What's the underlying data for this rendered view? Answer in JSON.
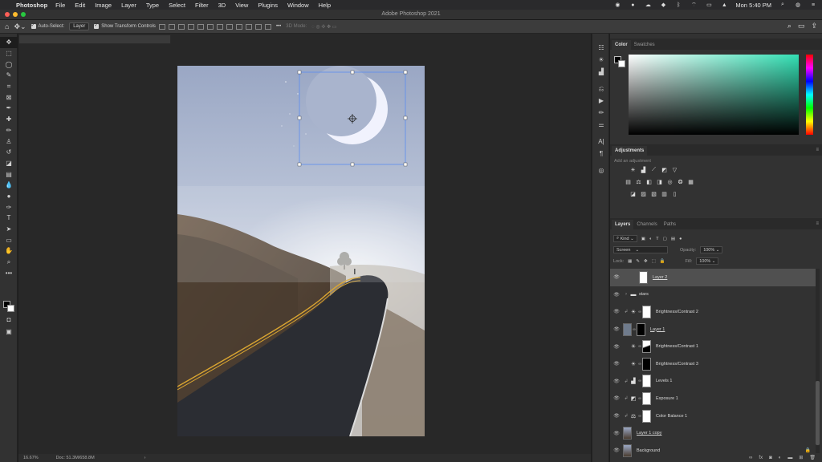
{
  "menubar": {
    "app_name": "Photoshop",
    "items": [
      "File",
      "Edit",
      "Image",
      "Layer",
      "Type",
      "Select",
      "Filter",
      "3D",
      "View",
      "Plugins",
      "Window",
      "Help"
    ],
    "clock": "Mon 5:40 PM"
  },
  "window": {
    "title": "Adobe Photoshop 2021"
  },
  "options": {
    "auto_select_label": "Auto-Select:",
    "auto_select_value": "Layer",
    "transform_label": "Show Transform Controls",
    "mode_3d": "3D Mode:"
  },
  "status": {
    "zoom": "16.67%",
    "doc": "Doc: 51.3M/658.8M",
    "arrow": "›"
  },
  "color_panel": {
    "tabs": [
      "Color",
      "Swatches"
    ],
    "accent": "#33e0b4"
  },
  "adjustments": {
    "title": "Adjustments",
    "hint": "Add an adjustment"
  },
  "layers_panel": {
    "tabs": [
      "Layers",
      "Channels",
      "Paths"
    ],
    "filter_kind": "Kind",
    "blend_mode": "Screen",
    "opacity_label": "Opacity:",
    "opacity_value": "100%",
    "lock_label": "Lock:",
    "fill_label": "Fill:",
    "fill_value": "100%",
    "layers": [
      {
        "name": "Layer 2",
        "type": "pixel",
        "selected": true,
        "underline": true
      },
      {
        "name": "stars",
        "type": "group"
      },
      {
        "name": "Brightness/Contrast 2",
        "type": "adjustment",
        "icon": "☀",
        "clip": true
      },
      {
        "name": "Layer 1",
        "type": "pixel-masked",
        "underline": true
      },
      {
        "name": "Brightness/Contrast 1",
        "type": "adjustment",
        "icon": "☀"
      },
      {
        "name": "Brightness/Contrast 3",
        "type": "adjustment",
        "icon": "☀"
      },
      {
        "name": "Levels 1",
        "type": "adjustment",
        "icon": "▟",
        "clip": true
      },
      {
        "name": "Exposure 1",
        "type": "adjustment",
        "icon": "◩",
        "clip": true
      },
      {
        "name": "Color Balance 1",
        "type": "adjustment",
        "icon": "⚖",
        "clip": true
      },
      {
        "name": "Layer 1 copy",
        "type": "pixel",
        "underline": true
      },
      {
        "name": "Background",
        "type": "pixel",
        "locked": true
      }
    ]
  }
}
